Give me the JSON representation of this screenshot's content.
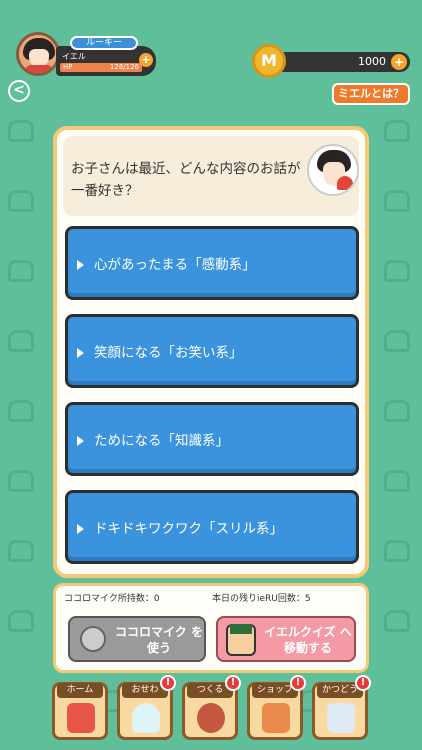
{
  "header": {
    "user_name": "ルーキー",
    "family_label": "イエル",
    "hp_label": "HP",
    "hp_value": "126/126",
    "coins": "1000",
    "about_button": "ミエルとは？"
  },
  "question": {
    "text": "お子さんは最近、どんな内容のお話が一番好き？"
  },
  "answers": [
    {
      "label": "心があったまる「感動系」"
    },
    {
      "label": "笑顔になる「お笑い系」"
    },
    {
      "label": "ためになる「知識系」"
    },
    {
      "label": "ドキドキワクワク「スリル系」"
    }
  ],
  "info": {
    "mic_count": "ココロマイク所持数：0",
    "remaining": "本日の残りieRU回数：5"
  },
  "actions": {
    "mic_button": "ココロマイク を使う",
    "quiz_button": "イエルクイズ へ移動する"
  },
  "nav": [
    {
      "label": "ホーム"
    },
    {
      "label": "おせわ",
      "badge": "!"
    },
    {
      "label": "つくる",
      "badge": "!"
    },
    {
      "label": "ショップ",
      "badge": "!"
    },
    {
      "label": "かつどう",
      "badge": "!"
    }
  ],
  "colors": {
    "background": "#5fbf9b",
    "answer_blue": "#3a93dc",
    "accent_orange": "#f07a2a",
    "quiz_pink": "#f39aa4"
  }
}
